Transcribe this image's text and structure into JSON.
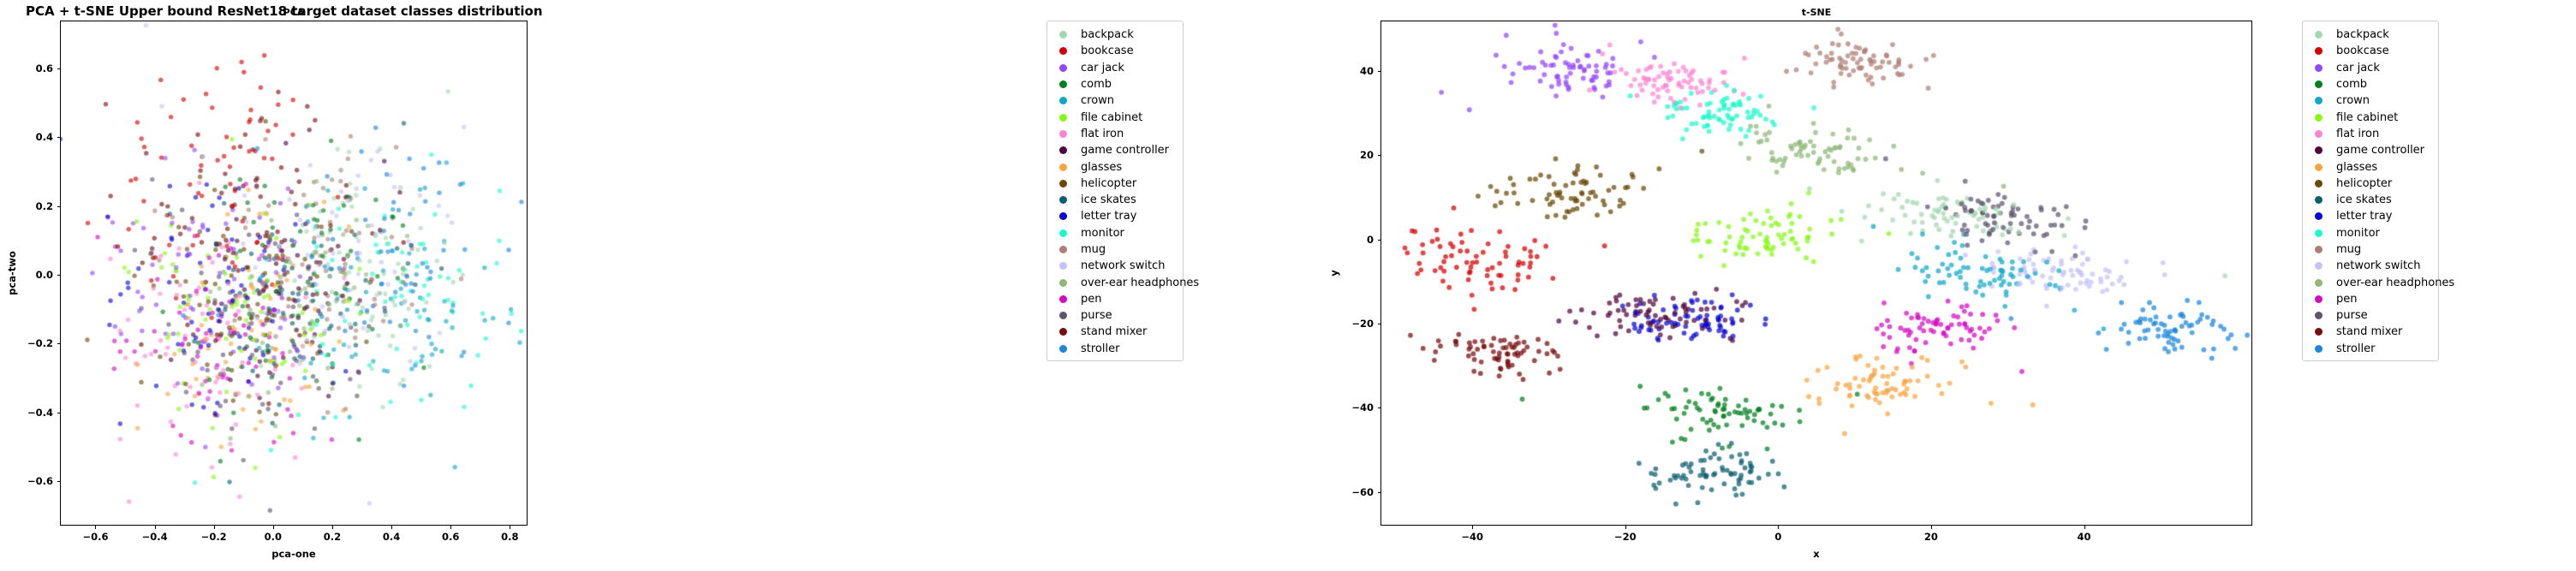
{
  "figure": {
    "suptitle": "PCA + t-SNE Upper bound ResNet18 target dataset classes distribution",
    "background": "#ffffff"
  },
  "classes": [
    {
      "label": "backpack",
      "color": "#a3d7b0"
    },
    {
      "label": "bookcase",
      "color": "#d40000"
    },
    {
      "label": "car jack",
      "color": "#9247fc"
    },
    {
      "label": "comb",
      "color": "#00801f"
    },
    {
      "label": "crown",
      "color": "#0fa8c8"
    },
    {
      "label": "file cabinet",
      "color": "#86f914"
    },
    {
      "label": "flat iron",
      "color": "#fd84d2"
    },
    {
      "label": "game controller",
      "color": "#51063f"
    },
    {
      "label": "glasses",
      "color": "#fba33f"
    },
    {
      "label": "helicopter",
      "color": "#6a4a06"
    },
    {
      "label": "ice skates",
      "color": "#0b6070"
    },
    {
      "label": "letter tray",
      "color": "#0b07d4"
    },
    {
      "label": "monitor",
      "color": "#1afbcb"
    },
    {
      "label": "mug",
      "color": "#ad7f76"
    },
    {
      "label": "network switch",
      "color": "#c3c2f9"
    },
    {
      "label": "over-ear headphones",
      "color": "#8eb877"
    },
    {
      "label": "pen",
      "color": "#d40ac2"
    },
    {
      "label": "purse",
      "color": "#5e5470"
    },
    {
      "label": "stand mixer",
      "color": "#780b0b"
    },
    {
      "label": "stroller",
      "color": "#1c86dd"
    }
  ],
  "panels": {
    "pca": {
      "title": "PCA",
      "xlabel": "pca-one",
      "ylabel": "pca-two",
      "xticks": [
        -0.6,
        -0.4,
        -0.2,
        0.0,
        0.2,
        0.4,
        0.6,
        0.8
      ],
      "xticklabels": [
        "−0.6",
        "−0.4",
        "−0.2",
        "0.0",
        "0.2",
        "0.4",
        "0.6",
        "0.8"
      ],
      "yticks": [
        0.6,
        0.4,
        0.2,
        0.0,
        -0.2,
        -0.4,
        -0.6
      ],
      "yticklabels": [
        "0.6",
        "0.4",
        "0.2",
        "0.0",
        "−0.2",
        "−0.4",
        "−0.6"
      ],
      "xlim": [
        -0.72,
        0.86
      ],
      "ylim": [
        -0.73,
        0.74
      ],
      "grid": false
    },
    "tsne": {
      "title": "t-SNE",
      "xlabel": "x",
      "ylabel": "y",
      "xticks": [
        -40,
        -20,
        0,
        20,
        40
      ],
      "xticklabels": [
        "−40",
        "−20",
        "0",
        "20",
        "40"
      ],
      "yticks": [
        40,
        20,
        0,
        -20,
        -40,
        -60
      ],
      "yticklabels": [
        "40",
        "20",
        "0",
        "−20",
        "−40",
        "−60"
      ],
      "xlim": [
        -52,
        62
      ],
      "ylim": [
        -68,
        52
      ],
      "grid": false
    }
  },
  "chart_data": [
    {
      "type": "scatter",
      "name": "PCA",
      "title": "PCA",
      "xlabel": "pca-one",
      "ylabel": "pca-two",
      "xlim": [
        -0.72,
        0.86
      ],
      "ylim": [
        -0.73,
        0.74
      ],
      "grid": false,
      "legend_position": "right",
      "point_size": 4.2,
      "point_alpha": 0.62,
      "n_per_class": 65,
      "series": [
        {
          "name": "backpack",
          "cx": 0.3,
          "cy": -0.02,
          "sx": 0.17,
          "sy": 0.18
        },
        {
          "name": "bookcase",
          "cx": -0.18,
          "cy": 0.26,
          "sx": 0.18,
          "sy": 0.18
        },
        {
          "name": "car jack",
          "cx": -0.27,
          "cy": -0.05,
          "sx": 0.16,
          "sy": 0.19
        },
        {
          "name": "comb",
          "cx": 0.05,
          "cy": 0.01,
          "sx": 0.18,
          "sy": 0.17
        },
        {
          "name": "crown",
          "cx": 0.42,
          "cy": -0.06,
          "sx": 0.18,
          "sy": 0.17
        },
        {
          "name": "file cabinet",
          "cx": -0.14,
          "cy": -0.12,
          "sx": 0.17,
          "sy": 0.16
        },
        {
          "name": "flat iron",
          "cx": -0.22,
          "cy": -0.23,
          "sx": 0.18,
          "sy": 0.17
        },
        {
          "name": "game controller",
          "cx": 0.03,
          "cy": -0.05,
          "sx": 0.17,
          "sy": 0.17
        },
        {
          "name": "glasses",
          "cx": -0.08,
          "cy": -0.13,
          "sx": 0.18,
          "sy": 0.18
        },
        {
          "name": "helicopter",
          "cx": -0.12,
          "cy": -0.05,
          "sx": 0.17,
          "sy": 0.17
        },
        {
          "name": "ice skates",
          "cx": 0.1,
          "cy": -0.1,
          "sx": 0.18,
          "sy": 0.16
        },
        {
          "name": "letter tray",
          "cx": -0.2,
          "cy": -0.06,
          "sx": 0.16,
          "sy": 0.17
        },
        {
          "name": "monitor",
          "cx": 0.46,
          "cy": -0.04,
          "sx": 0.17,
          "sy": 0.17
        },
        {
          "name": "mug",
          "cx": 0.12,
          "cy": 0.02,
          "sx": 0.19,
          "sy": 0.17
        },
        {
          "name": "network switch",
          "cx": 0.22,
          "cy": 0.04,
          "sx": 0.18,
          "sy": 0.17
        },
        {
          "name": "over-ear headphones",
          "cx": 0.2,
          "cy": -0.05,
          "sx": 0.18,
          "sy": 0.17
        },
        {
          "name": "pen",
          "cx": -0.17,
          "cy": -0.16,
          "sx": 0.17,
          "sy": 0.17
        },
        {
          "name": "purse",
          "cx": -0.05,
          "cy": -0.07,
          "sx": 0.18,
          "sy": 0.18
        },
        {
          "name": "stand mixer",
          "cx": -0.1,
          "cy": 0.14,
          "sx": 0.18,
          "sy": 0.18
        },
        {
          "name": "stroller",
          "cx": 0.38,
          "cy": 0.05,
          "sx": 0.18,
          "sy": 0.17
        }
      ]
    },
    {
      "type": "scatter",
      "name": "t-SNE",
      "title": "t-SNE",
      "xlabel": "x",
      "ylabel": "y",
      "xlim": [
        -52,
        62
      ],
      "ylim": [
        -68,
        52
      ],
      "grid": false,
      "legend_position": "right",
      "point_size": 4.6,
      "point_alpha": 0.72,
      "n_per_class": 72,
      "series": [
        {
          "name": "backpack",
          "cx": 22.0,
          "cy": 6.5,
          "sx": 6.5,
          "sy": 2.6,
          "rot": -18
        },
        {
          "name": "bookcase",
          "cx": -40.0,
          "cy": -5.0,
          "sx": 5.2,
          "sy": 3.6,
          "rot": 10
        },
        {
          "name": "car jack",
          "cx": -28.0,
          "cy": 40.0,
          "sx": 4.8,
          "sy": 3.2,
          "rot": -12
        },
        {
          "name": "comb",
          "cx": -8.0,
          "cy": -41.0,
          "sx": 4.6,
          "sy": 3.0,
          "rot": 0
        },
        {
          "name": "crown",
          "cx": 26.0,
          "cy": -8.0,
          "sx": 6.2,
          "sy": 3.0,
          "rot": -25
        },
        {
          "name": "file cabinet",
          "cx": -2.0,
          "cy": 1.0,
          "sx": 4.4,
          "sy": 3.2,
          "rot": 0
        },
        {
          "name": "flat iron",
          "cx": -14.0,
          "cy": 38.0,
          "sx": 4.4,
          "sy": 3.0,
          "rot": -15
        },
        {
          "name": "game controller",
          "cx": -16.0,
          "cy": -18.0,
          "sx": 5.2,
          "sy": 3.0,
          "rot": 5
        },
        {
          "name": "glasses",
          "cx": 13.0,
          "cy": -34.0,
          "sx": 4.2,
          "sy": 2.8,
          "rot": 0
        },
        {
          "name": "helicopter",
          "cx": -27.0,
          "cy": 11.0,
          "sx": 4.4,
          "sy": 3.0,
          "rot": 0
        },
        {
          "name": "ice skates",
          "cx": -8.0,
          "cy": -55.0,
          "sx": 4.2,
          "sy": 3.0,
          "rot": 0
        },
        {
          "name": "letter tray",
          "cx": -12.0,
          "cy": -19.0,
          "sx": 4.6,
          "sy": 2.8,
          "rot": 0
        },
        {
          "name": "monitor",
          "cx": -8.0,
          "cy": 30.0,
          "sx": 4.0,
          "sy": 2.6,
          "rot": 0
        },
        {
          "name": "mug",
          "cx": 11.0,
          "cy": 42.0,
          "sx": 4.4,
          "sy": 2.6,
          "rot": -10
        },
        {
          "name": "network switch",
          "cx": 37.0,
          "cy": -7.0,
          "sx": 4.6,
          "sy": 2.8,
          "rot": -8
        },
        {
          "name": "over-ear headphones",
          "cx": 5.0,
          "cy": 21.0,
          "sx": 5.2,
          "sy": 2.6,
          "rot": -18
        },
        {
          "name": "pen",
          "cx": 21.0,
          "cy": -21.0,
          "sx": 4.8,
          "sy": 2.8,
          "rot": 0
        },
        {
          "name": "purse",
          "cx": 30.0,
          "cy": 5.0,
          "sx": 4.8,
          "sy": 3.0,
          "rot": -22
        },
        {
          "name": "stand mixer",
          "cx": -37.0,
          "cy": -27.0,
          "sx": 4.2,
          "sy": 2.6,
          "rot": 0
        },
        {
          "name": "stroller",
          "cx": 51.0,
          "cy": -21.0,
          "sx": 4.4,
          "sy": 3.2,
          "rot": 0
        }
      ]
    }
  ]
}
